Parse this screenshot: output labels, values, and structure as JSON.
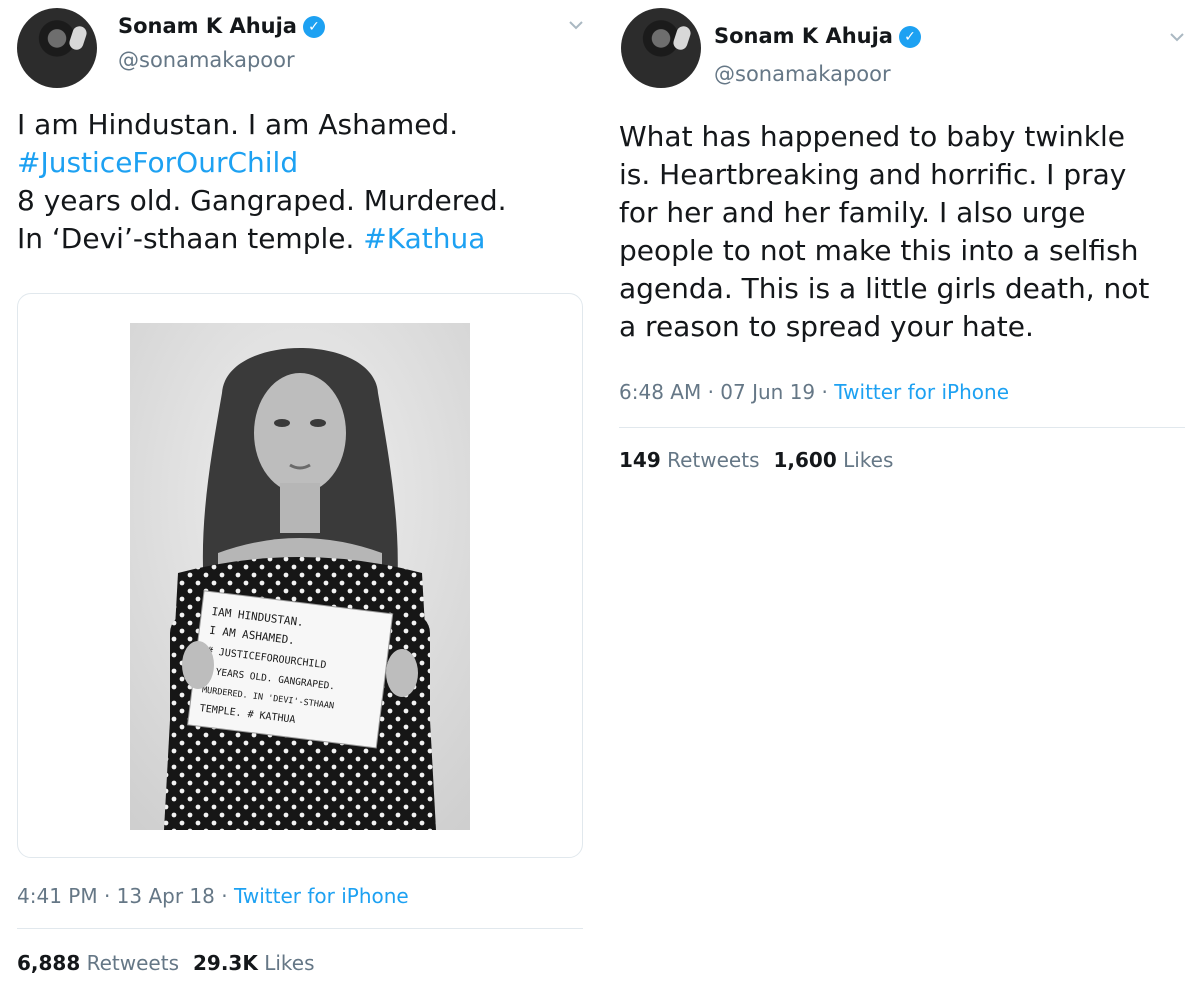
{
  "tweets": [
    {
      "author": {
        "name": "Sonam K Ahuja",
        "handle": "@sonamakapoor",
        "verified": true
      },
      "text": {
        "line1": "I am Hindustan. I am Ashamed.",
        "hashtag1": "#JusticeForOurChild",
        "line3": "8 years old. Gangraped. Murdered.",
        "line4": "In ‘Devi’-sthaan temple.",
        "hashtag2": "#Kathua"
      },
      "media": {
        "sign_lines": [
          "IAM HINDUSTAN.",
          "I AM ASHAMED.",
          "# JUSTICEFOROURCHILD",
          "8 YEARS OLD. GANGRAPED.",
          "MURDERED. IN 'DEVI'-STHAAN",
          "TEMPLE. # KATHUA"
        ]
      },
      "time": "4:41 PM",
      "date": "13 Apr 18",
      "source": "Twitter for iPhone",
      "retweets": "6,888",
      "retweets_label": "Retweets",
      "likes": "29.3K",
      "likes_label": "Likes"
    },
    {
      "author": {
        "name": "Sonam K Ahuja",
        "handle": "@sonamakapoor",
        "verified": true
      },
      "text": {
        "lines": [
          "What has happened to baby twinkle",
          "is. Heartbreaking and horrific. I pray",
          "for her and her family. I also urge",
          "people to not make this into a selfish",
          "agenda. This is a little girls death, not",
          "a reason to spread your hate."
        ]
      },
      "time": "6:48 AM",
      "date": "07 Jun 19",
      "source": "Twitter for iPhone",
      "retweets": "149",
      "retweets_label": "Retweets",
      "likes": "1,600",
      "likes_label": "Likes"
    }
  ],
  "icons": {
    "verified": "verified-badge-icon",
    "chevron": "chevron-down-icon"
  },
  "colors": {
    "link": "#1da1f2",
    "text": "#14171a",
    "muted": "#657786",
    "border": "#e1e8ed"
  }
}
